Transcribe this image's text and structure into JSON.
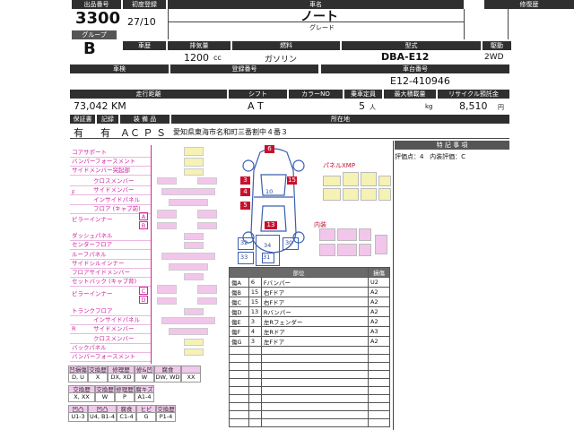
{
  "header": {
    "lot_no_label": "出品番号",
    "first_reg_label": "初度登録",
    "car_name_label": "車名",
    "history_label": "修復歴",
    "lot_no": "3300",
    "first_reg": "27/10",
    "car_name": "ノート",
    "grade_label": "グレード",
    "grade_group_label": "グループ",
    "group": "B",
    "type_label": "車歴",
    "displacement_label": "排気量",
    "fuel_label": "燃料",
    "model_label": "型式",
    "drive_label": "駆動",
    "displacement": "1200",
    "displacement_unit": "cc",
    "fuel": "ガソリン",
    "model": "DBA-E12",
    "drive": "2WD",
    "inspection_label": "車検",
    "plate_label": "登録番号",
    "chassis_label": "車台番号",
    "chassis": "E12-410946",
    "mileage_label": "走行距離",
    "shift_label": "シフト",
    "color_label": "カラーNO",
    "capacity_label": "乗車定員",
    "max_load_label": "最大積載量",
    "recycle_label": "リサイクル預託金",
    "mileage": "73,042 KM",
    "shift": "A T",
    "capacity": "5",
    "capacity_unit": "人",
    "load_unit": "kg",
    "recycle": "8,510",
    "recycle_unit": "円",
    "warranty_label": "保証書",
    "record_label": "記録",
    "equipment_label": "装 備 品",
    "location_label": "所在地",
    "warranty": "有",
    "record": "有",
    "equipment": "ＡＣ Ｐ Ｓ",
    "location": "愛知県東海市名和町三番割中４番３"
  },
  "special": {
    "title": "特 記 事 項",
    "score_label": "評価点：",
    "score": "4",
    "interior_label": "内装評価：",
    "interior": "C"
  },
  "parts_list": [
    {
      "text": "コアサポート",
      "top": false
    },
    {
      "text": "バンパーフォースメント",
      "top": false
    },
    {
      "text": "サイドメンバー突起部",
      "top": false
    },
    {
      "text": "クロスメンバー",
      "top": false
    },
    {
      "text": "サイドメンバー",
      "top": false
    },
    {
      "text": "インサイドパネル",
      "top": false
    },
    {
      "text": "フロア (キャブ前)",
      "top": false
    },
    {
      "text": "ダッシュパネル",
      "top": false
    },
    {
      "text": "センターフロア",
      "top": false
    },
    {
      "text": "ルーフパネル",
      "top": false
    },
    {
      "text": "サイドシルインナー",
      "top": false
    },
    {
      "text": "フロアサイドメンバー",
      "top": false
    },
    {
      "text": "セットバック (キャブ背)",
      "top": false
    },
    {
      "text": "トランクフロア",
      "top": false
    },
    {
      "text": "インサイドパネル",
      "top": false
    },
    {
      "text": "サイドメンバー",
      "top": false
    },
    {
      "text": "クロスメンバー",
      "top": false
    },
    {
      "text": "バックパネル",
      "top": false
    },
    {
      "text": "バンパーフォースメント",
      "top": false
    }
  ],
  "part_group_labels": {
    "front": "F",
    "pillar_inner": "ピラーインナー",
    "rear": "R",
    "a": "A",
    "b": "B",
    "c": "C",
    "d": "D"
  },
  "diagram": {
    "panel_label": "パネルXMP",
    "interior_label": "内装",
    "points": [
      "6",
      "15",
      "3",
      "4",
      "5",
      "13",
      "10",
      "34",
      "32",
      "33",
      "30",
      "31"
    ]
  },
  "damage_table": {
    "header": [
      "部位",
      "損傷"
    ],
    "rows": [
      [
        "傷A",
        "6",
        "Fバンパー",
        "U2"
      ],
      [
        "傷B",
        "15",
        "右Fドア",
        "A2"
      ],
      [
        "傷C",
        "15",
        "右Fドア",
        "A2"
      ],
      [
        "傷D",
        "13",
        "Rバンパー",
        "A2"
      ],
      [
        "傷E",
        "3",
        "左Rフェンダー",
        "A2"
      ],
      [
        "傷F",
        "4",
        "左Rドア",
        "A3"
      ],
      [
        "傷G",
        "3",
        "左Fドア",
        "A2"
      ]
    ]
  },
  "legend": [
    {
      "heads": [
        "凹損傷",
        "交換歴",
        "修理歴",
        "修&凹",
        "腐食"
      ],
      "vals": [
        "D, U",
        "X",
        "DX, XD",
        "W",
        "DW, WD",
        "XX"
      ]
    },
    {
      "heads": [
        "交換歴",
        "交換歴",
        "修理歴",
        "腐キズ"
      ],
      "vals": [
        "X, XX",
        "W",
        "P",
        "A1-4"
      ]
    },
    {
      "heads": [
        "凹凸",
        "凹凸",
        "腐食",
        "ヒビ",
        "交換歴"
      ],
      "vals": [
        "U1-3",
        "U4, B1-4",
        "C1-4",
        "G",
        "P1-4"
      ]
    }
  ]
}
